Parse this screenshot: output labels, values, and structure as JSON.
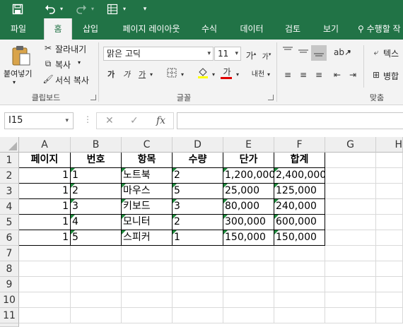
{
  "qat": {
    "save_icon": "save-icon",
    "undo_icon": "undo-icon",
    "redo_icon": "redo-icon",
    "form_icon": "form-icon",
    "customize_icon": "customize-icon"
  },
  "tabs": [
    {
      "label": "파일"
    },
    {
      "label": "홈",
      "active": true
    },
    {
      "label": "삽입"
    },
    {
      "label": "페이지 레이아웃"
    },
    {
      "label": "수식"
    },
    {
      "label": "데이터"
    },
    {
      "label": "검토"
    },
    {
      "label": "보기"
    },
    {
      "label": "수행할 작"
    }
  ],
  "ribbon": {
    "clipboard": {
      "paste": "붙여넣기",
      "cut": "잘라내기",
      "copy": "복사",
      "format_painter": "서식 복사",
      "group": "클립보드"
    },
    "font": {
      "font_name": "맑은 고딕",
      "font_size": "11",
      "bold": "가",
      "italic": "가",
      "underline": "가",
      "font_color_glyph": "가",
      "phonetic": "내천",
      "group": "글꼴"
    },
    "alignment": {
      "wrap_text": "텍스",
      "merge": "병합",
      "group": "맞춤"
    }
  },
  "formula_bar": {
    "name_box": "I15",
    "formula": ""
  },
  "grid": {
    "columns": [
      "A",
      "B",
      "C",
      "D",
      "E",
      "F",
      "G",
      "H"
    ],
    "rows": [
      "1",
      "2",
      "3",
      "4",
      "5",
      "6",
      "7",
      "8",
      "9",
      "10",
      "11"
    ],
    "header": [
      "페이지",
      "번호",
      "항목",
      "수량",
      "단가",
      "합계"
    ],
    "data": [
      [
        "1",
        "1",
        "노트북",
        "2",
        "1,200,000",
        "2,400,000"
      ],
      [
        "1",
        "2",
        "마우스",
        "5",
        "25,000",
        "125,000"
      ],
      [
        "1",
        "3",
        "키보드",
        "3",
        "80,000",
        "240,000"
      ],
      [
        "1",
        "4",
        "모니터",
        "2",
        "300,000",
        "600,000"
      ],
      [
        "1",
        "5",
        "스피커",
        "1",
        "150,000",
        "150,000"
      ]
    ]
  },
  "colors": {
    "accent": "#217346",
    "ribbon_bg": "#f3f3f3",
    "error_triangle": "#1e8a3c"
  }
}
